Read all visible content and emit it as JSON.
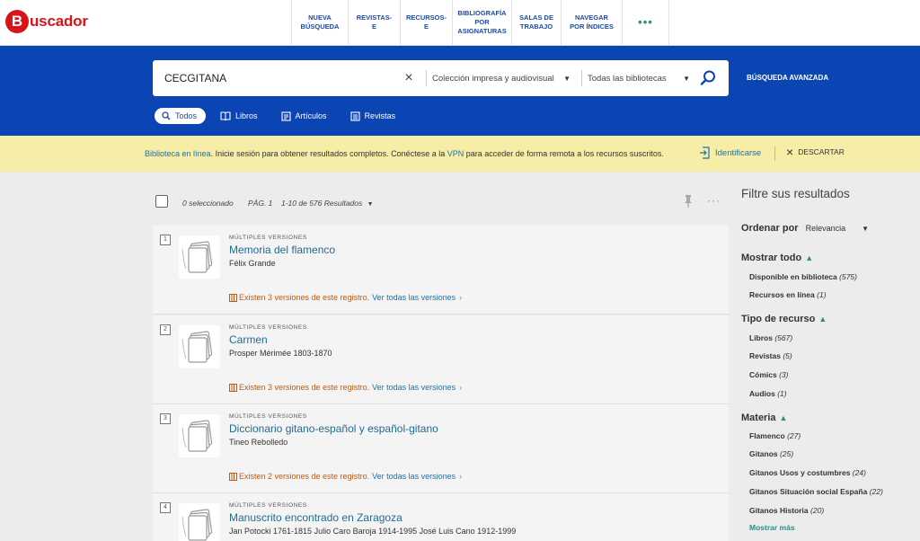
{
  "brand": {
    "logo_letter": "B",
    "logo_rest": "uscador",
    "color": "#d7141a"
  },
  "nav": [
    {
      "label": "NUEVA BÚSQUEDA"
    },
    {
      "label": "REVISTAS-E"
    },
    {
      "label": "RECURSOS-E"
    },
    {
      "label": "BIBLIOGRAFÍA POR ASIGNATURAS"
    },
    {
      "label": "SALAS DE TRABAJO"
    },
    {
      "label": "NAVEGAR POR ÍNDICES"
    },
    {
      "label": "•••"
    }
  ],
  "search": {
    "query": "CECGITANA",
    "clear_icon": "×",
    "scope1": "Colección impresa y audiovisual",
    "scope2": "Todas las bibliotecas",
    "advanced": "BÚSQUEDA AVANZADA"
  },
  "tabs": [
    {
      "label": "Todos",
      "active": true
    },
    {
      "label": "Libros",
      "active": false
    },
    {
      "label": "Artículos",
      "active": false
    },
    {
      "label": "Revistas",
      "active": false
    }
  ],
  "notice": {
    "link1": "Biblioteca en línea",
    "text1": ". Inicie sesión para obtener resultados completos. Conéctese a la ",
    "link2": "VPN",
    "text2": " para acceder de forma remota a los recursos suscritos.",
    "login": "Identificarse",
    "dismiss": "DESCARTAR"
  },
  "toolbar": {
    "selected": "0 seleccionado",
    "page": "PÁG. 1",
    "count": "1-10 de 576 Resultados"
  },
  "results": [
    {
      "num": "1",
      "type": "MÚLTIPLES VERSIONES",
      "title": "Memoria del flamenco",
      "author": "Félix Grande",
      "versions": "Existen 3 versiones de este registro.",
      "see_all": "Ver todas las versiones"
    },
    {
      "num": "2",
      "type": "MÚLTIPLES VERSIONES",
      "title": "Carmen",
      "author": "Prosper Mérimée 1803-1870",
      "versions": "Existen 3 versiones de este registro.",
      "see_all": "Ver todas las versiones"
    },
    {
      "num": "3",
      "type": "MÚLTIPLES VERSIONES",
      "title": "Diccionario gitano-español y español-gitano",
      "author": "Tineo Rebolledo",
      "versions": "Existen 2 versiones de este registro.",
      "see_all": "Ver todas las versiones"
    },
    {
      "num": "4",
      "type": "MÚLTIPLES VERSIONES",
      "title": "Manuscrito encontrado en Zaragoza",
      "author": "Jan Potocki 1761-1815 Julio Caro Baroja 1914-1995 José Luis Cano 1912-1999",
      "versions": "",
      "see_all": ""
    }
  ],
  "sidebar": {
    "title": "Filtre sus resultados",
    "sort_label": "Ordenar por",
    "sort_value": "Relevancia",
    "show_all": "Mostrar todo",
    "show_items": [
      {
        "label": "Disponible en biblioteca",
        "count": "(575)"
      },
      {
        "label": "Recursos en línea",
        "count": "(1)"
      }
    ],
    "type_title": "Tipo de recurso",
    "type_items": [
      {
        "label": "Libros",
        "count": "(567)"
      },
      {
        "label": "Revistas",
        "count": "(5)"
      },
      {
        "label": "Cómics",
        "count": "(3)"
      },
      {
        "label": "Audios",
        "count": "(1)"
      }
    ],
    "subject_title": "Materia",
    "subject_items": [
      {
        "label": "Flamenco",
        "count": "(27)"
      },
      {
        "label": "Gitanos",
        "count": "(25)"
      },
      {
        "label": "Gitanos Usos y costumbres",
        "count": "(24)"
      },
      {
        "label": "Gitanos Situación social España",
        "count": "(22)"
      },
      {
        "label": "Gitanos Historia",
        "count": "(20)"
      }
    ],
    "show_more": "Mostrar más"
  },
  "colors": {
    "primary": "#0b45b3",
    "notice": "#f6eda6",
    "link": "#2270a8",
    "versions": "#c8590c",
    "teal": "#2b8e8a"
  }
}
